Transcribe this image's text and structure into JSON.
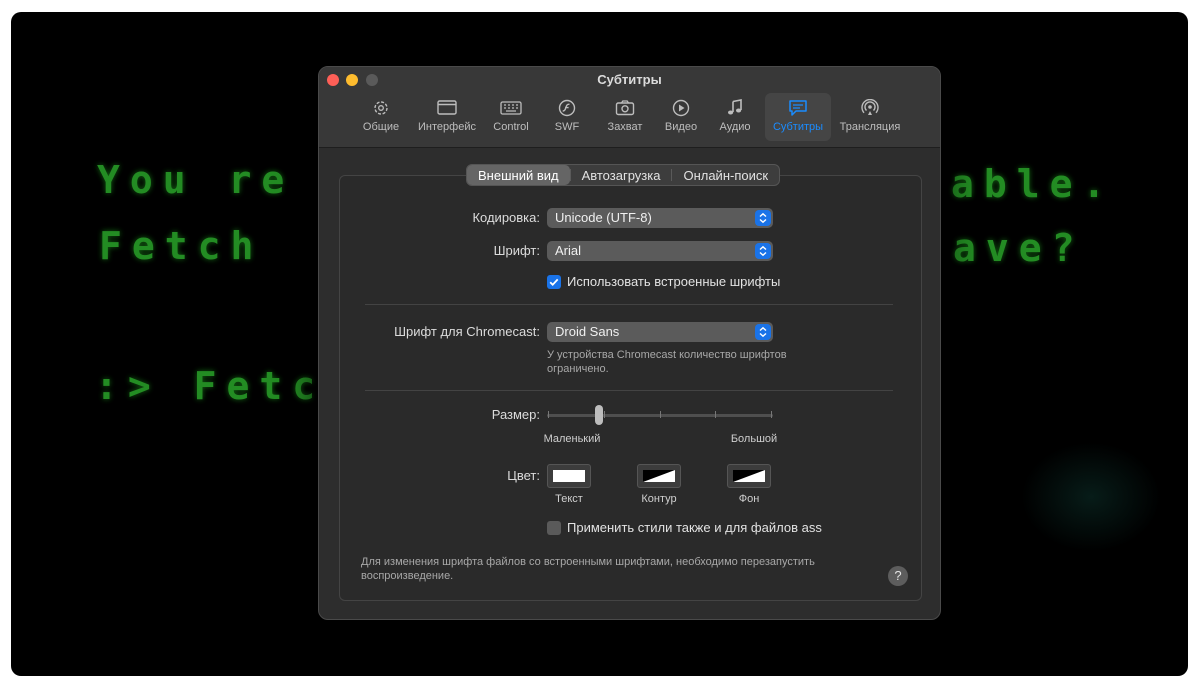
{
  "background_video": {
    "lines": [
      "You re",
      "Fetch",
      ":> Fetc",
      "able.",
      "ave?"
    ]
  },
  "window": {
    "title": "Субтитры"
  },
  "toolbar": {
    "items": [
      {
        "label": "Общие",
        "icon": "gear-icon"
      },
      {
        "label": "Интерфейс",
        "icon": "window-icon"
      },
      {
        "label": "Control",
        "icon": "keyboard-icon"
      },
      {
        "label": "SWF",
        "icon": "flash-icon"
      },
      {
        "label": "Захват",
        "icon": "camera-icon"
      },
      {
        "label": "Видео",
        "icon": "play-icon"
      },
      {
        "label": "Аудио",
        "icon": "music-note-icon"
      },
      {
        "label": "Субтитры",
        "icon": "subtitles-icon",
        "active": true
      },
      {
        "label": "Трансляция",
        "icon": "broadcast-icon"
      }
    ]
  },
  "tabs": [
    "Внешний вид",
    "Автозагрузка",
    "Онлайн-поиск"
  ],
  "form": {
    "encoding_label": "Кодировка:",
    "encoding_value": "Unicode (UTF-8)",
    "font_label": "Шрифт:",
    "font_value": "Arial",
    "embedded_fonts_label": "Использовать встроенные шрифты",
    "embedded_fonts_checked": true,
    "chromecast_font_label": "Шрифт для Chromecast:",
    "chromecast_font_value": "Droid Sans",
    "chromecast_note": "У устройства Chromecast количество шрифтов ограничено.",
    "size_label": "Размер:",
    "size_min_label": "Маленький",
    "size_max_label": "Большой",
    "size_level": 0.22,
    "color_label": "Цвет:",
    "color_text_label": "Текст",
    "color_outline_label": "Контур",
    "color_bg_label": "Фон",
    "apply_ass_label": "Применить стили также и для файлов ass",
    "apply_ass_checked": false,
    "footer_note": "Для изменения шрифта файлов со встроенными шрифтами, необходимо перезапустить воспроизведение.",
    "help": "?"
  },
  "colors": {
    "accent": "#1a8cff",
    "video_text": "#2aa52a"
  }
}
